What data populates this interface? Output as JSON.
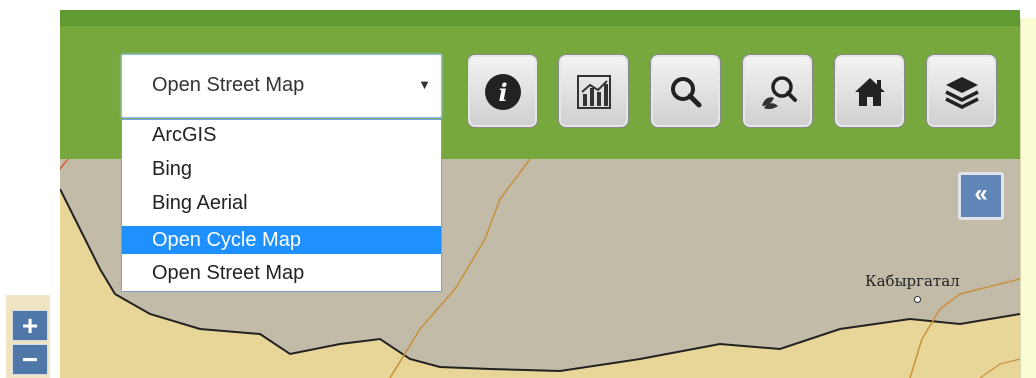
{
  "basemap_select": {
    "value": "Open Street Map",
    "caret": "▼",
    "options": [
      {
        "label": "ArcGIS"
      },
      {
        "label": "Bing"
      },
      {
        "label": "Bing Aerial"
      },
      {
        "label": "Open Cycle Map",
        "highlighted": true
      },
      {
        "label": "Open Street Map"
      }
    ]
  },
  "toolbar_icons": [
    "info-icon",
    "chart-icon",
    "search-icon",
    "plant-search-icon",
    "home-icon",
    "layers-icon"
  ],
  "collapse_label": "«",
  "map": {
    "place_name": "Кабыргатал"
  },
  "zoom": {
    "in_label": "+",
    "out_label": "−"
  },
  "colors": {
    "toolbar_green": "#76a83e",
    "map_background": "#c2bba7",
    "selected_option": "#1e90ff",
    "collapse_button": "#5f86b7",
    "zoom_button": "#4f78a8"
  }
}
